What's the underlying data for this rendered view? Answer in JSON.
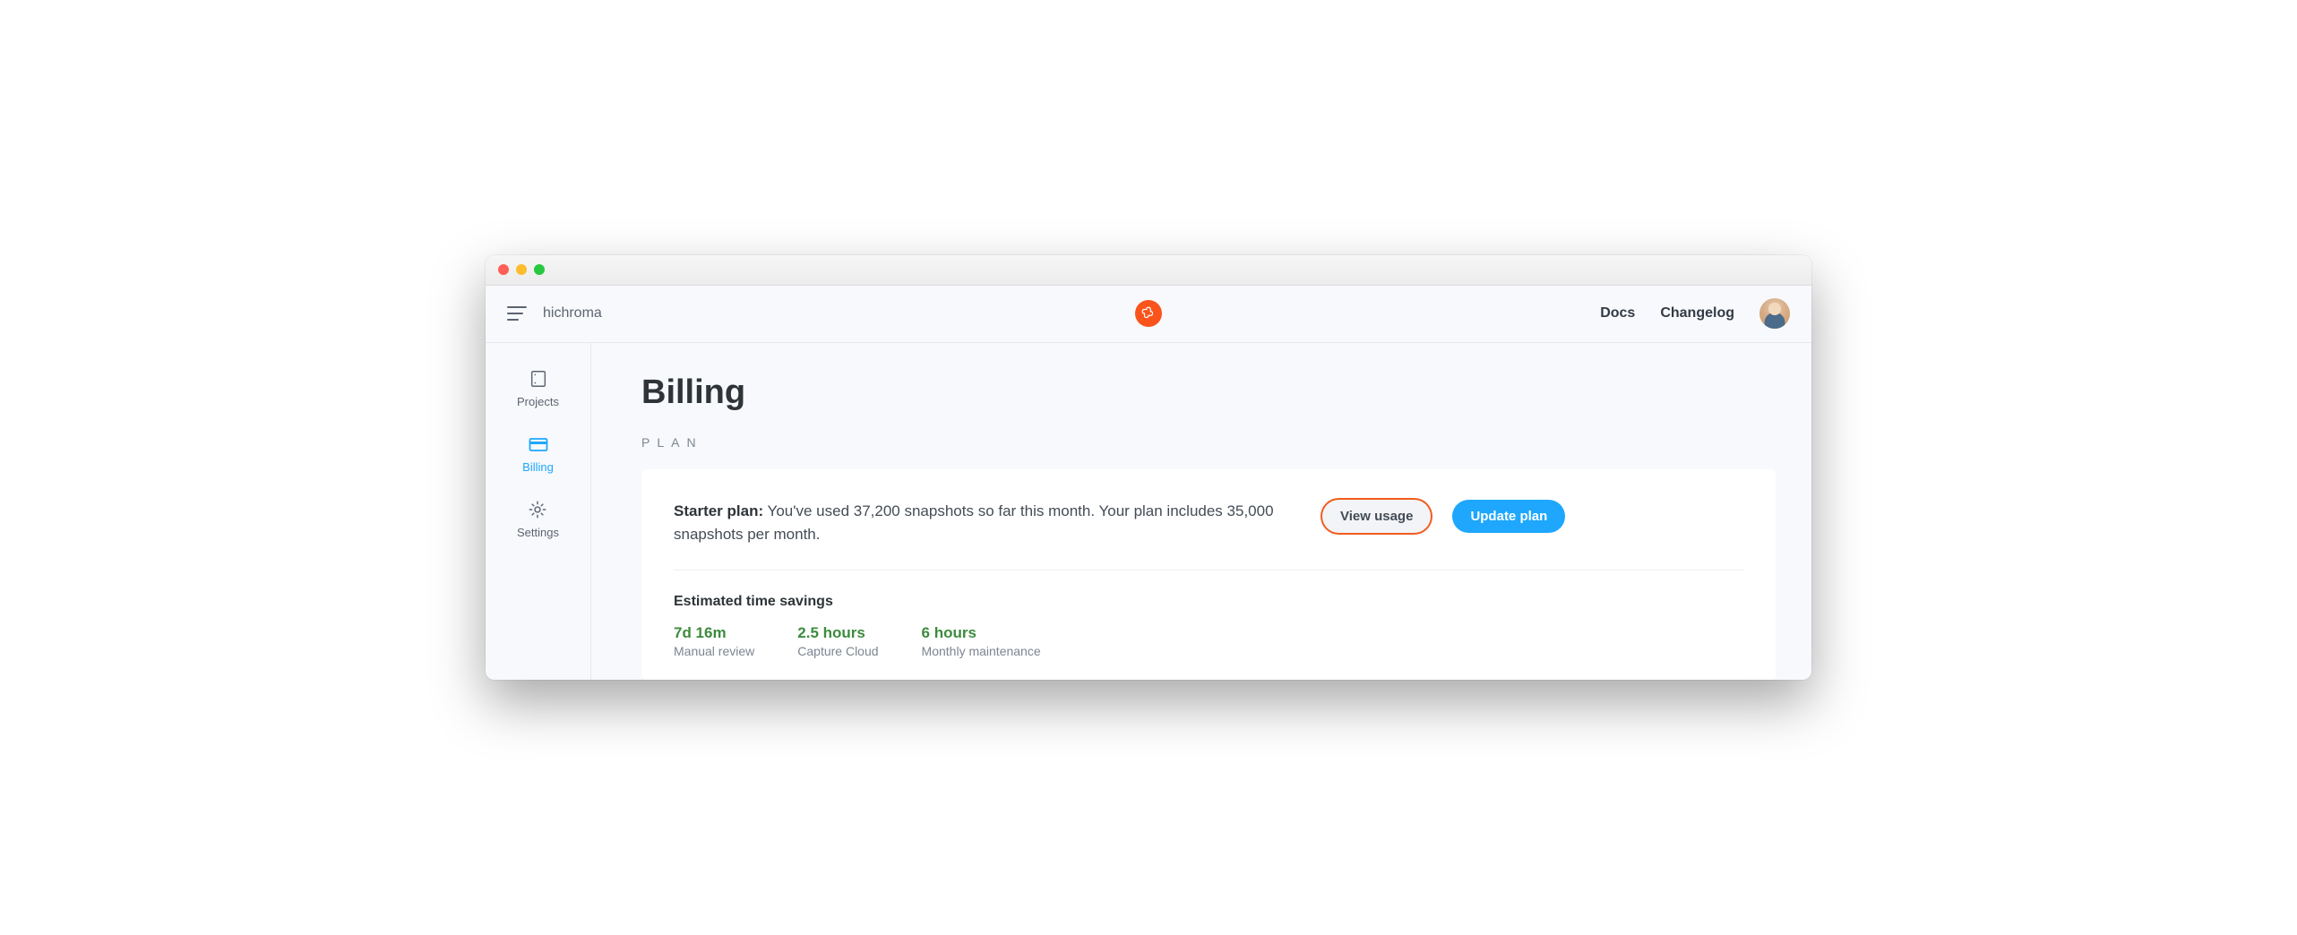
{
  "topbar": {
    "org_name": "hichroma",
    "nav": {
      "docs": "Docs",
      "changelog": "Changelog"
    }
  },
  "sidebar": {
    "items": [
      {
        "label": "Projects"
      },
      {
        "label": "Billing"
      },
      {
        "label": "Settings"
      }
    ]
  },
  "page": {
    "title": "Billing",
    "section_label": "PLAN"
  },
  "plan_card": {
    "plan_name": "Starter plan:",
    "usage_text": " You've used 37,200 snapshots so far this month. Your plan includes 35,000 snapshots per month.",
    "view_usage_label": "View usage",
    "update_plan_label": "Update plan"
  },
  "savings": {
    "title": "Estimated time savings",
    "stats": [
      {
        "value": "7d 16m",
        "label": "Manual review"
      },
      {
        "value": "2.5 hours",
        "label": "Capture Cloud"
      },
      {
        "value": "6 hours",
        "label": "Monthly maintenance"
      }
    ]
  }
}
